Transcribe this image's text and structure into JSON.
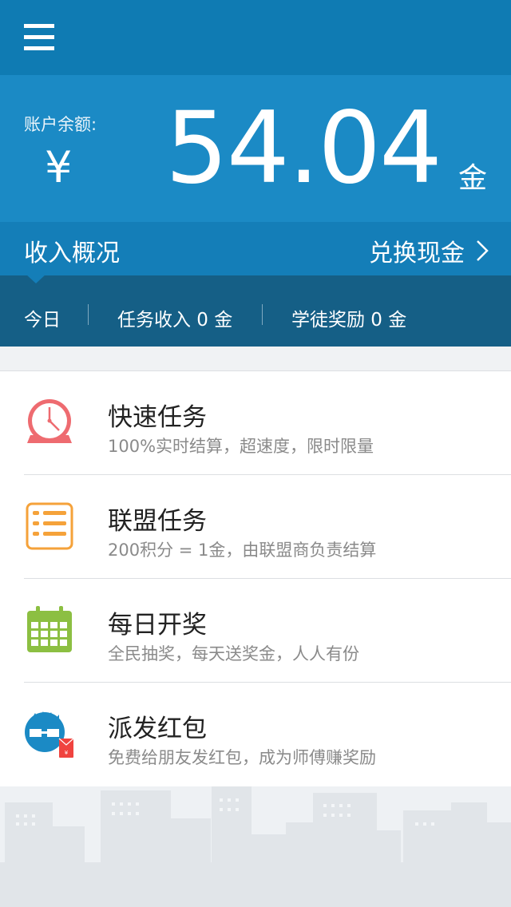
{
  "header": {
    "menu_icon": "hamburger-menu-icon"
  },
  "balance": {
    "label": "账户余额:",
    "currency_symbol": "¥",
    "amount": "54.04",
    "unit": "金"
  },
  "income": {
    "title": "收入概况",
    "exchange_label": "兑换现金",
    "exchange_icon": "chevron-right-icon"
  },
  "stats": {
    "today_label": "今日",
    "task_income": "任务收入 0 金",
    "apprentice_reward": "学徒奖励 0 金"
  },
  "tasks": [
    {
      "title": "快速任务",
      "desc": "100%实时结算，超速度，限时限量",
      "icon": "alarm-clock-icon",
      "color": "#ee6b70"
    },
    {
      "title": "联盟任务",
      "desc": "200积分 = 1金，由联盟商负责结算",
      "icon": "list-icon",
      "color": "#f5a23a"
    },
    {
      "title": "每日开奖",
      "desc": "全民抽奖，每天送奖金，人人有份",
      "icon": "calendar-icon",
      "color": "#8cbf42"
    },
    {
      "title": "派发红包",
      "desc": "免费给朋友发红包，成为师傅赚奖励",
      "icon": "red-envelope-avatar-icon",
      "color": "#1b8ac5"
    }
  ],
  "colors": {
    "header": "#0f7bb3",
    "balance_bg": "#1b8ac5",
    "income_bar": "#147eb8",
    "stats_bg": "#155f86"
  }
}
